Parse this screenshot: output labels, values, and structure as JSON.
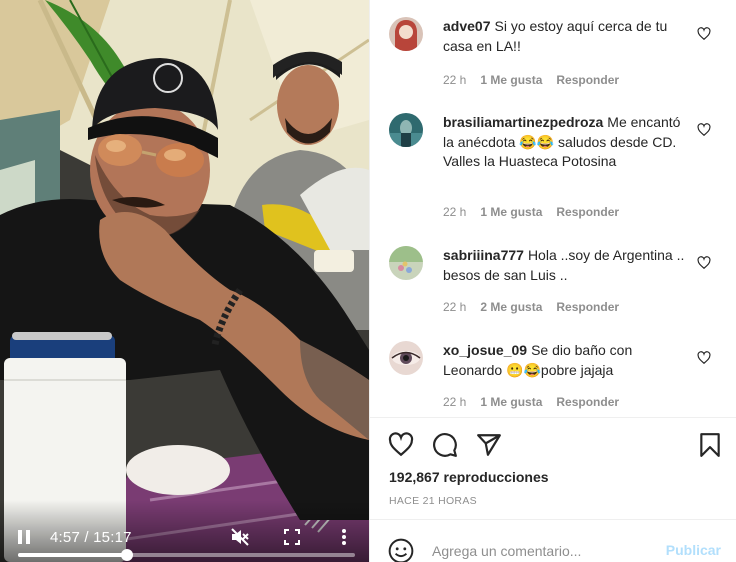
{
  "video": {
    "current_time": "4:57",
    "duration": "15:17",
    "time_separator": "/",
    "progress": 0.324,
    "play_state": "paused-icon",
    "muted": true
  },
  "comments": [
    {
      "username": "adve07",
      "text": "Si yo estoy aquí cerca de tu casa en LA!!",
      "time": "22 h",
      "likes": "1 Me gusta",
      "reply": "Responder",
      "avatar_color": "#b8453a"
    },
    {
      "username": "brasiliamartinezpedroza",
      "text": "Me encantó la anécdota 😂😂 saludos desde CD. Valles la Huasteca Potosina",
      "time": "22 h",
      "likes": "1 Me gusta",
      "reply": "Responder",
      "avatar_color": "#4f7f8c"
    },
    {
      "username": "sabriiina777",
      "text": "Hola ..soy de Argentina .. besos de san Luis ..",
      "time": "22 h",
      "likes": "2 Me gusta",
      "reply": "Responder",
      "avatar_color": "#9dbf8a"
    },
    {
      "username": "xo_josue_09",
      "text": "Se dio baño con Leonardo 😬😂pobre jajaja",
      "time": "22 h",
      "likes": "1 Me gusta",
      "reply": "Responder",
      "avatar_color": "#c9a9a2"
    }
  ],
  "post": {
    "views": "192,867 reproducciones",
    "time_ago": "HACE 21 HORAS"
  },
  "add_comment": {
    "placeholder": "Agrega un comentario...",
    "publish_label": "Publicar"
  },
  "colors": {
    "text": "#262626",
    "muted": "#8e8e8e",
    "link_disabled": "#b2dffc"
  }
}
